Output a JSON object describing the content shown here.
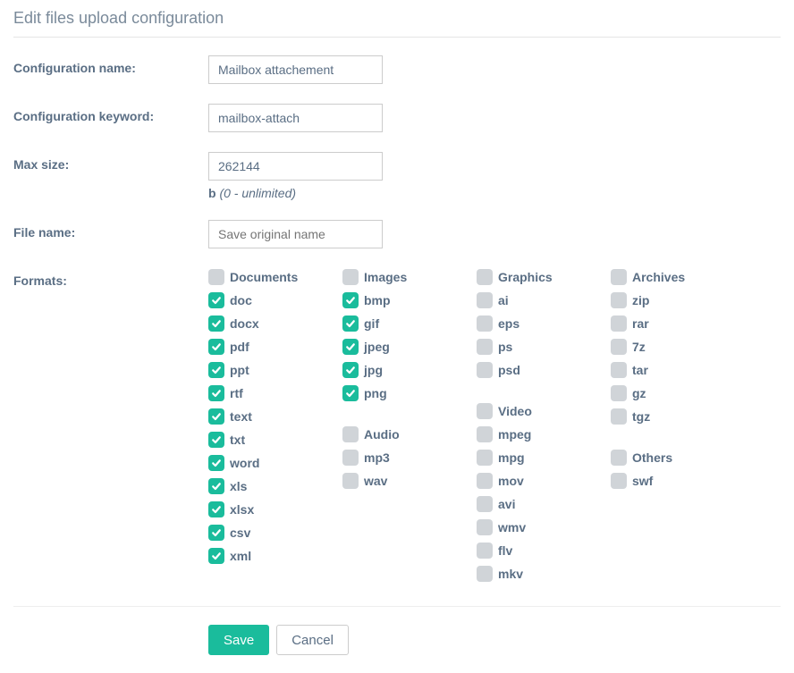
{
  "title": "Edit files upload configuration",
  "labels": {
    "config_name": "Configuration name:",
    "config_keyword": "Configuration keyword:",
    "max_size": "Max size:",
    "file_name": "File name:",
    "formats": "Formats:"
  },
  "fields": {
    "config_name": "Mailbox attachement",
    "config_keyword": "mailbox-attach",
    "max_size": "262144",
    "max_size_unit": "b",
    "max_size_hint": "(0 - unlimited)",
    "file_name_placeholder": "Save original name"
  },
  "formats": {
    "columns": [
      [
        {
          "title": "Documents",
          "checked": false,
          "items": [
            {
              "label": "doc",
              "checked": true
            },
            {
              "label": "docx",
              "checked": true
            },
            {
              "label": "pdf",
              "checked": true
            },
            {
              "label": "ppt",
              "checked": true
            },
            {
              "label": "rtf",
              "checked": true
            },
            {
              "label": "text",
              "checked": true
            },
            {
              "label": "txt",
              "checked": true
            },
            {
              "label": "word",
              "checked": true
            },
            {
              "label": "xls",
              "checked": true
            },
            {
              "label": "xlsx",
              "checked": true
            },
            {
              "label": "csv",
              "checked": true
            },
            {
              "label": "xml",
              "checked": true
            }
          ]
        }
      ],
      [
        {
          "title": "Images",
          "checked": false,
          "items": [
            {
              "label": "bmp",
              "checked": true
            },
            {
              "label": "gif",
              "checked": true
            },
            {
              "label": "jpeg",
              "checked": true
            },
            {
              "label": "jpg",
              "checked": true
            },
            {
              "label": "png",
              "checked": true
            }
          ]
        },
        {
          "title": "Audio",
          "checked": false,
          "items": [
            {
              "label": "mp3",
              "checked": false
            },
            {
              "label": "wav",
              "checked": false
            }
          ]
        }
      ],
      [
        {
          "title": "Graphics",
          "checked": false,
          "items": [
            {
              "label": "ai",
              "checked": false
            },
            {
              "label": "eps",
              "checked": false
            },
            {
              "label": "ps",
              "checked": false
            },
            {
              "label": "psd",
              "checked": false
            }
          ]
        },
        {
          "title": "Video",
          "checked": false,
          "items": [
            {
              "label": "mpeg",
              "checked": false
            },
            {
              "label": "mpg",
              "checked": false
            },
            {
              "label": "mov",
              "checked": false
            },
            {
              "label": "avi",
              "checked": false
            },
            {
              "label": "wmv",
              "checked": false
            },
            {
              "label": "flv",
              "checked": false
            },
            {
              "label": "mkv",
              "checked": false
            }
          ]
        }
      ],
      [
        {
          "title": "Archives",
          "checked": false,
          "items": [
            {
              "label": "zip",
              "checked": false
            },
            {
              "label": "rar",
              "checked": false
            },
            {
              "label": "7z",
              "checked": false
            },
            {
              "label": "tar",
              "checked": false
            },
            {
              "label": "gz",
              "checked": false
            },
            {
              "label": "tgz",
              "checked": false
            }
          ]
        },
        {
          "title": "Others",
          "checked": false,
          "items": [
            {
              "label": "swf",
              "checked": false
            }
          ]
        }
      ]
    ]
  },
  "buttons": {
    "save": "Save",
    "cancel": "Cancel"
  }
}
